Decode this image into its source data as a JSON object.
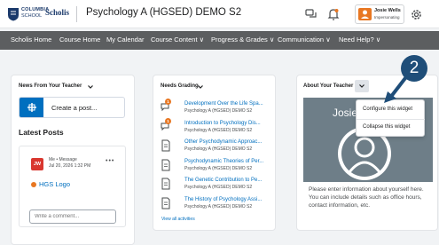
{
  "header": {
    "logo_line1": "COLUMBIA",
    "logo_line2": "SCHOOL",
    "logo_brand": "Scholis",
    "course_title": "Psychology A (HGSED) DEMO S2",
    "user_name": "Josie Wells",
    "user_role": "Impersonating"
  },
  "nav": {
    "items": [
      "Scholis Home",
      "Course Home",
      "My Calendar",
      "Course Content ∨",
      "Progress & Grades ∨",
      "Communication ∨",
      "Need Help? ∨"
    ]
  },
  "news_widget": {
    "title": "News From Your Teacher",
    "create_post": "Create a post...",
    "latest_posts": "Latest Posts",
    "post": {
      "avatar": "JW",
      "author": "Me • Message",
      "date": "Jul 20, 2026 1:32 PM",
      "more": "•••",
      "link": "HGS Logo"
    },
    "comment_placeholder": "Write a comment..."
  },
  "grading_widget": {
    "title": "Needs Grading",
    "items": [
      {
        "title": "Development Over the Life Spa...",
        "sub": "Psychology A (HGSED) DEMO S2",
        "badge": "1"
      },
      {
        "title": "Introduction to Psychology Dis...",
        "sub": "Psychology A (HGSED) DEMO S2",
        "badge": "1"
      },
      {
        "title": "Other Psychodynamic Approac...",
        "sub": "Psychology A (HGSED) DEMO S2",
        "badge": ""
      },
      {
        "title": "Psychodynamic Theories of Per...",
        "sub": "Psychology A (HGSED) DEMO S2",
        "badge": ""
      },
      {
        "title": "The Genetic Contribution to Pe...",
        "sub": "Psychology A (HGSED) DEMO S2",
        "badge": ""
      },
      {
        "title": "The History of Psychology Assi...",
        "sub": "Psychology A (HGSED) DEMO S2",
        "badge": ""
      }
    ],
    "view_all": "View all activities"
  },
  "teacher_widget": {
    "title": "About Your Teacher",
    "name_fragment": "Josie",
    "description": "Please enter information about yourself here. You can include details such as office hours, contact information, etc.",
    "menu": [
      "Configure this widget",
      "Collapse this widget"
    ]
  },
  "step_marker": "2",
  "colors": {
    "nav_bg": "#5c5e60",
    "link": "#006fbf",
    "accent": "#e87722",
    "step": "#1f4e79"
  }
}
